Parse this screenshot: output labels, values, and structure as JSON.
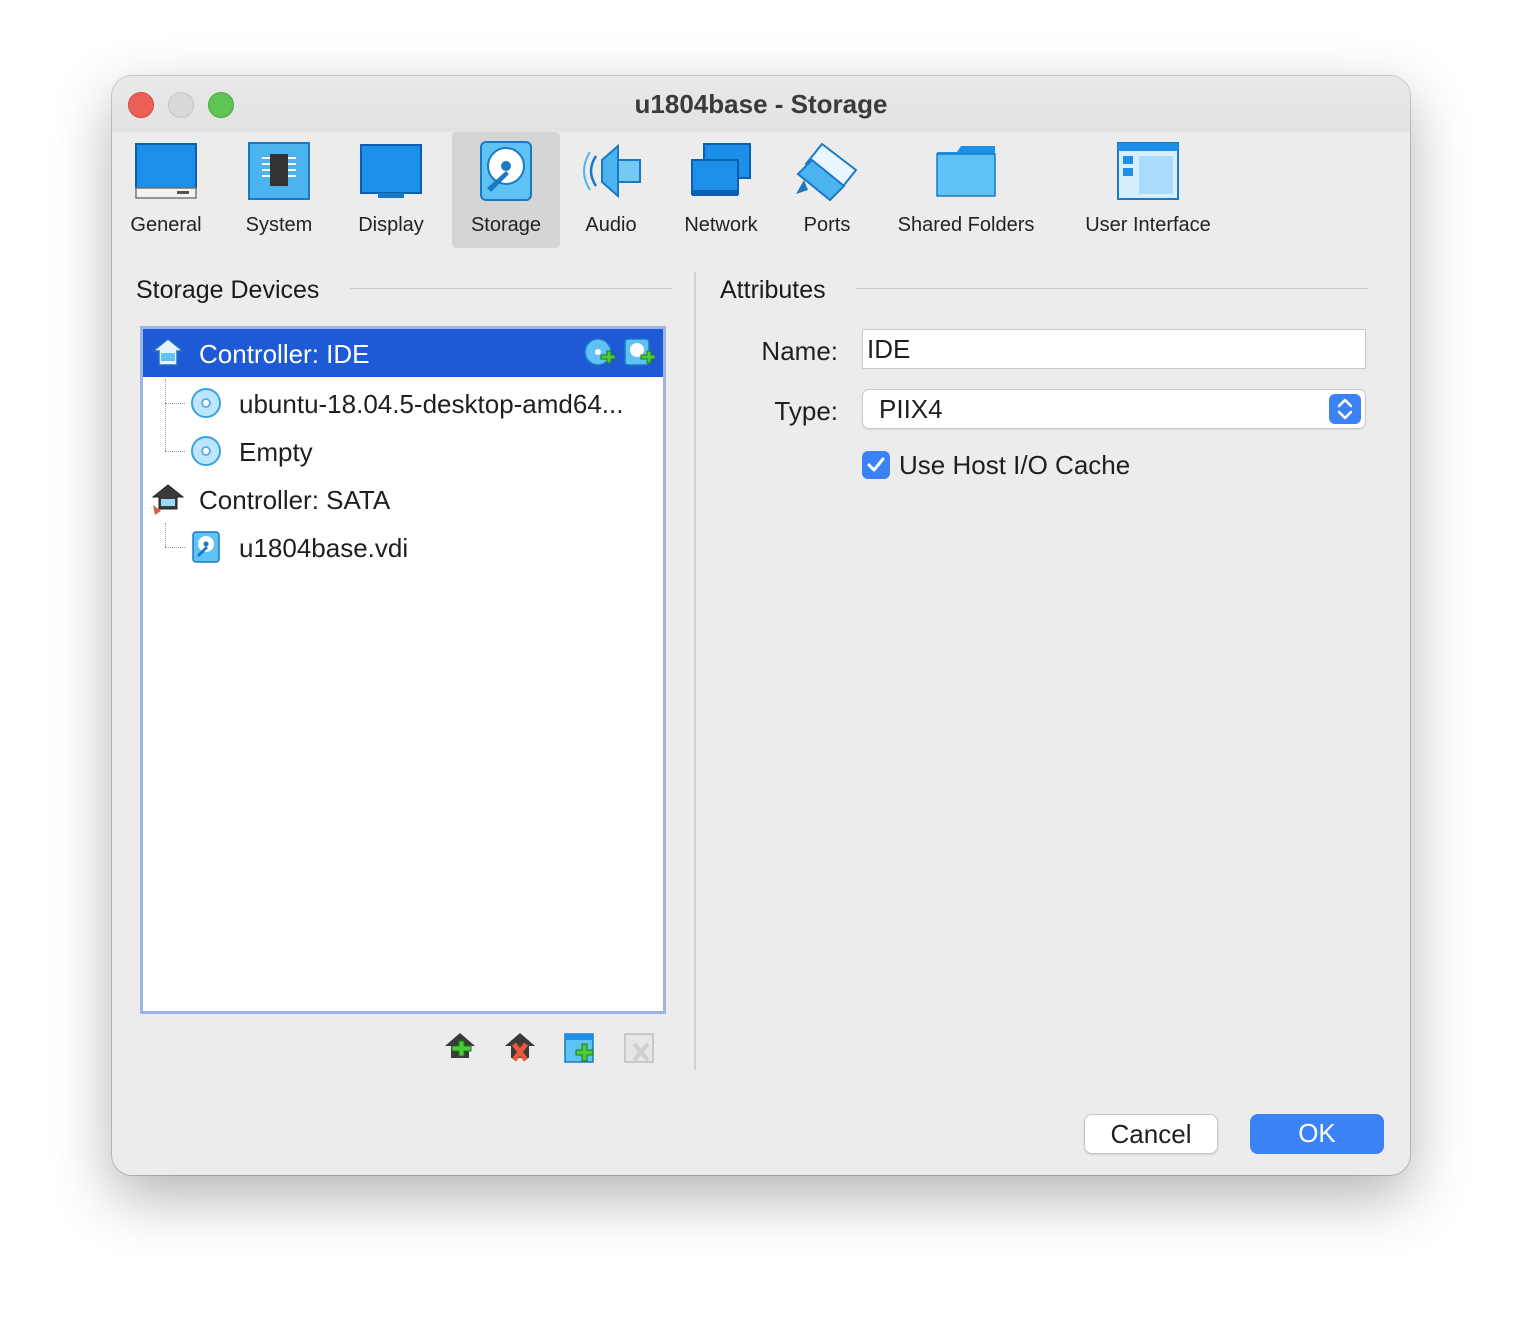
{
  "window": {
    "title": "u1804base - Storage"
  },
  "toolbar": {
    "items": [
      {
        "label": "General",
        "icon": "general-icon",
        "selected": false
      },
      {
        "label": "System",
        "icon": "system-chip-icon",
        "selected": false
      },
      {
        "label": "Display",
        "icon": "display-monitor-icon",
        "selected": false
      },
      {
        "label": "Storage",
        "icon": "storage-disk-icon",
        "selected": true
      },
      {
        "label": "Audio",
        "icon": "audio-speaker-icon",
        "selected": false
      },
      {
        "label": "Network",
        "icon": "network-icon",
        "selected": false
      },
      {
        "label": "Ports",
        "icon": "ports-icon",
        "selected": false
      },
      {
        "label": "Shared Folders",
        "icon": "folder-icon",
        "selected": false
      },
      {
        "label": "User Interface",
        "icon": "user-interface-icon",
        "selected": false
      }
    ]
  },
  "storage": {
    "title": "Storage Devices",
    "tree": [
      {
        "label": "Controller: IDE",
        "type": "controller",
        "icon": "ide-controller-icon",
        "selected": true
      },
      {
        "label": "ubuntu-18.04.5-desktop-amd64...",
        "type": "optical",
        "icon": "optical-disc-icon"
      },
      {
        "label": "Empty",
        "type": "optical",
        "icon": "optical-disc-icon"
      },
      {
        "label": "Controller: SATA",
        "type": "controller",
        "icon": "sata-controller-icon"
      },
      {
        "label": "u1804base.vdi",
        "type": "disk",
        "icon": "hard-disk-icon"
      }
    ],
    "buttons": [
      "add-controller",
      "remove-controller",
      "add-attachment",
      "remove-attachment"
    ]
  },
  "attributes": {
    "title": "Attributes",
    "name_label": "Name:",
    "name_value": "IDE",
    "type_label": "Type:",
    "type_value": "PIIX4",
    "cache_label": "Use Host I/O Cache",
    "cache_checked": true
  },
  "footer": {
    "cancel": "Cancel",
    "ok": "OK"
  },
  "colors": {
    "accent": "#3b82f6",
    "selection": "#1f5ad6",
    "window_bg": "#ececec"
  }
}
